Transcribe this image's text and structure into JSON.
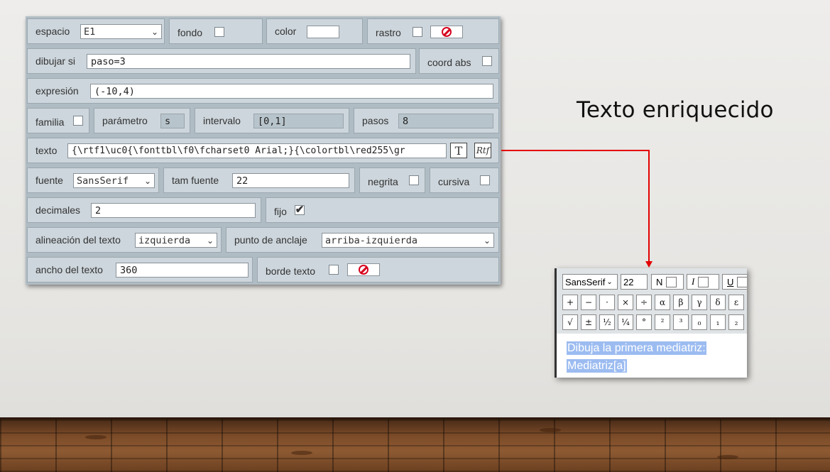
{
  "heading": "Texto enriquecido",
  "panel": {
    "espacio_label": "espacio",
    "espacio_value": "E1",
    "fondo_label": "fondo",
    "color_label": "color",
    "rastro_label": "rastro",
    "dibujar_si_label": "dibujar si",
    "dibujar_si_value": "paso=3",
    "coord_abs_label": "coord abs",
    "expresion_label": "expresión",
    "expresion_value": "(-10,4)",
    "familia_label": "familia",
    "parametro_label": "parámetro",
    "parametro_value": "s",
    "intervalo_label": "intervalo",
    "intervalo_value": "[0,1]",
    "pasos_label": "pasos",
    "pasos_value": "8",
    "texto_label": "texto",
    "texto_value": "{\\rtf1\\uc0{\\fonttbl\\f0\\fcharset0 Arial;}{\\colortbl\\red255\\gr",
    "fuente_label": "fuente",
    "fuente_value": "SansSerif",
    "tam_fuente_label": "tam fuente",
    "tam_fuente_value": "22",
    "negrita_label": "negrita",
    "cursiva_label": "cursiva",
    "decimales_label": "decimales",
    "decimales_value": "2",
    "fijo_label": "fijo",
    "fijo_checked": true,
    "alineacion_label": "alineación del texto",
    "alineacion_value": "izquierda",
    "anclaje_label": "punto de anclaje",
    "anclaje_value": "arriba-izquierda",
    "ancho_label": "ancho del texto",
    "ancho_value": "360",
    "borde_label": "borde texto",
    "btn_T": "T",
    "btn_Rtf": "Rtf"
  },
  "editor": {
    "font": "SansSerif",
    "size": "22",
    "bold": "N",
    "italic": "I",
    "underline": "U",
    "row2_symbols": [
      "+",
      "−",
      "·",
      "×",
      "÷",
      "α",
      "β",
      "γ",
      "δ",
      "ε"
    ],
    "row3_symbols": [
      "√",
      "±",
      "½",
      "¼",
      "°",
      "²",
      "³",
      "₀",
      "₁",
      "₂"
    ],
    "line1": "Dibuja la primera mediatriz:",
    "line2": "Mediatriz[a]"
  },
  "colors": {
    "connector": "#e30000",
    "panel": "#cdd6dc",
    "highlight": "#9cbcf1"
  }
}
